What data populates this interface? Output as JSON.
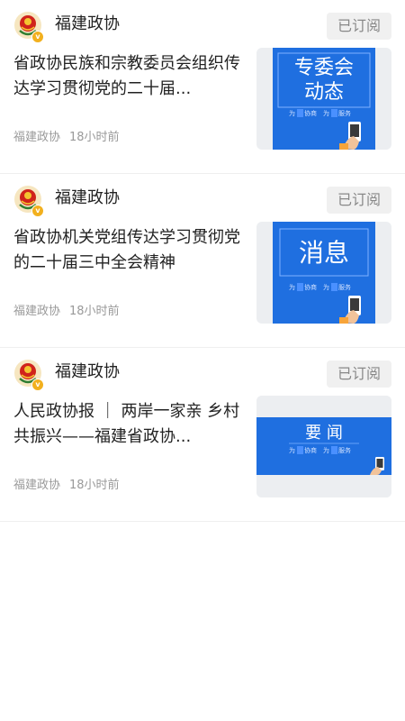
{
  "feed": [
    {
      "source": "福建政协",
      "subscribe_label": "已订阅",
      "title": "省政协民族和宗教委员会组织传达学习贯彻党的二十届...",
      "author": "福建政协",
      "time": "18小时前",
      "thumb": {
        "headline": "专委会动态",
        "line1": "专委会",
        "line2": "动态",
        "tag1": "为",
        "tag1b": "协商",
        "tag2": "为",
        "tag2b": "服务",
        "icon": "phone-hand-icon"
      }
    },
    {
      "source": "福建政协",
      "subscribe_label": "已订阅",
      "title": "省政协机关党组传达学习贯彻党的二十届三中全会精神",
      "author": "福建政协",
      "time": "18小时前",
      "thumb": {
        "headline": "消息",
        "tag1": "为",
        "tag1b": "协商",
        "tag2": "为",
        "tag2b": "服务",
        "icon": "phone-hand-icon"
      }
    },
    {
      "source": "福建政协",
      "subscribe_label": "已订阅",
      "title": "人民政协报 ｜ 两岸一家亲 乡村共振兴——福建省政协...",
      "author": "福建政协",
      "time": "18小时前",
      "thumb": {
        "headline": "要 闻",
        "tag1": "为",
        "tag1b": "协商",
        "tag2": "为",
        "tag2b": "服务",
        "icon": "phone-hand-icon"
      }
    }
  ],
  "colors": {
    "thumb_blue": "#1f6fe0",
    "badge": "#f2b01e",
    "avatar_red": "#d0231b"
  }
}
